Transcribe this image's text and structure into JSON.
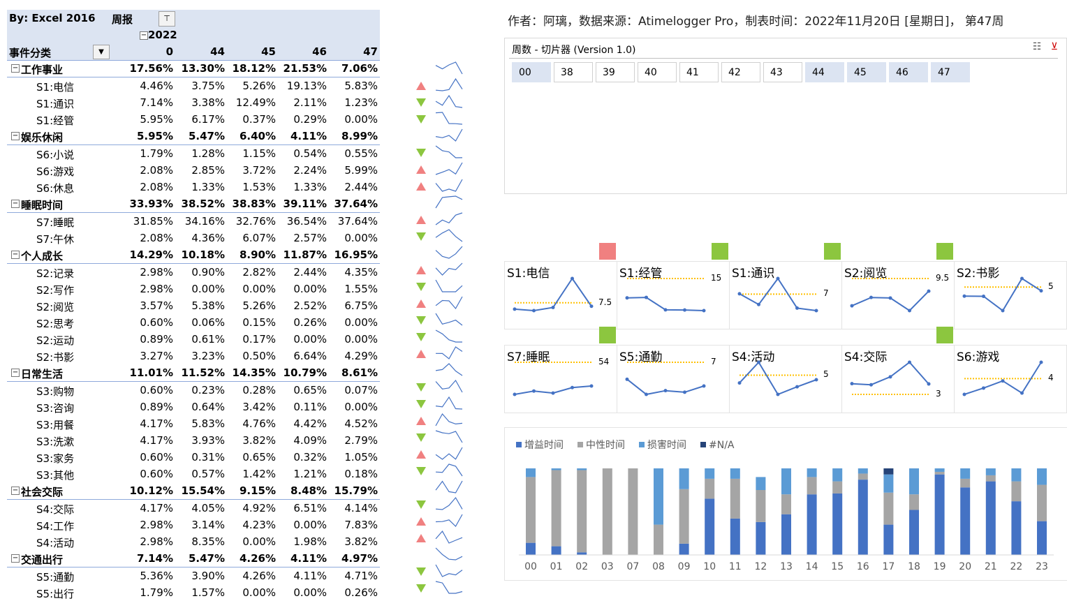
{
  "pivot": {
    "by_label": "By:  Excel 2016",
    "report_label": "周报",
    "year": "2022",
    "row_header": "事件分类",
    "columns": [
      "0",
      "44",
      "45",
      "46",
      "47"
    ],
    "rows": [
      {
        "type": "cat",
        "label": "工作事业",
        "values": [
          "17.56%",
          "13.30%",
          "18.12%",
          "21.53%",
          "7.06%"
        ],
        "trend": "up"
      },
      {
        "type": "sub",
        "label": "S1:电信",
        "values": [
          "4.46%",
          "3.75%",
          "5.26%",
          "19.13%",
          "5.83%"
        ],
        "trend": "up"
      },
      {
        "type": "sub",
        "label": "S1:通识",
        "values": [
          "7.14%",
          "3.38%",
          "12.49%",
          "2.11%",
          "1.23%"
        ],
        "trend": "down"
      },
      {
        "type": "sub",
        "label": "S1:经管",
        "values": [
          "5.95%",
          "6.17%",
          "0.37%",
          "0.29%",
          "0.00%"
        ],
        "trend": "down"
      },
      {
        "type": "cat",
        "label": "娱乐休闲",
        "values": [
          "5.95%",
          "5.47%",
          "6.40%",
          "4.11%",
          "8.99%"
        ],
        "trend": "up"
      },
      {
        "type": "sub",
        "label": "S6:小说",
        "values": [
          "1.79%",
          "1.28%",
          "1.15%",
          "0.54%",
          "0.55%"
        ],
        "trend": "down"
      },
      {
        "type": "sub",
        "label": "S6:游戏",
        "values": [
          "2.08%",
          "2.85%",
          "3.72%",
          "2.24%",
          "5.99%"
        ],
        "trend": "up"
      },
      {
        "type": "sub",
        "label": "S6:休息",
        "values": [
          "2.08%",
          "1.33%",
          "1.53%",
          "1.33%",
          "2.44%"
        ],
        "trend": "up"
      },
      {
        "type": "cat",
        "label": "睡眠时间",
        "values": [
          "33.93%",
          "38.52%",
          "38.83%",
          "39.11%",
          "37.64%"
        ],
        "trend": "up"
      },
      {
        "type": "sub",
        "label": "S7:睡眠",
        "values": [
          "31.85%",
          "34.16%",
          "32.76%",
          "36.54%",
          "37.64%"
        ],
        "trend": "up"
      },
      {
        "type": "sub",
        "label": "S7:午休",
        "values": [
          "2.08%",
          "4.36%",
          "6.07%",
          "2.57%",
          "0.00%"
        ],
        "trend": "down"
      },
      {
        "type": "cat",
        "label": "个人成长",
        "values": [
          "14.29%",
          "10.18%",
          "8.90%",
          "11.87%",
          "16.95%"
        ],
        "trend": "up"
      },
      {
        "type": "sub",
        "label": "S2:记录",
        "values": [
          "2.98%",
          "0.90%",
          "2.82%",
          "2.44%",
          "4.35%"
        ],
        "trend": "up"
      },
      {
        "type": "sub",
        "label": "S2:写作",
        "values": [
          "2.98%",
          "0.00%",
          "0.00%",
          "0.00%",
          "1.55%"
        ],
        "trend": "down"
      },
      {
        "type": "sub",
        "label": "S2:阅览",
        "values": [
          "3.57%",
          "5.38%",
          "5.26%",
          "2.52%",
          "6.75%"
        ],
        "trend": "up"
      },
      {
        "type": "sub",
        "label": "S2:思考",
        "values": [
          "0.60%",
          "0.06%",
          "0.15%",
          "0.26%",
          "0.00%"
        ],
        "trend": "down"
      },
      {
        "type": "sub",
        "label": "S2:运动",
        "values": [
          "0.89%",
          "0.61%",
          "0.17%",
          "0.00%",
          "0.00%"
        ],
        "trend": "down"
      },
      {
        "type": "sub",
        "label": "S2:书影",
        "values": [
          "3.27%",
          "3.23%",
          "0.50%",
          "6.64%",
          "4.29%"
        ],
        "trend": "up"
      },
      {
        "type": "cat",
        "label": "日常生活",
        "values": [
          "11.01%",
          "11.52%",
          "14.35%",
          "10.79%",
          "8.61%"
        ],
        "trend": "down"
      },
      {
        "type": "sub",
        "label": "S3:购物",
        "values": [
          "0.60%",
          "0.23%",
          "0.28%",
          "0.65%",
          "0.07%"
        ],
        "trend": "down"
      },
      {
        "type": "sub",
        "label": "S3:咨询",
        "values": [
          "0.89%",
          "0.64%",
          "3.42%",
          "0.11%",
          "0.00%"
        ],
        "trend": "down"
      },
      {
        "type": "sub",
        "label": "S3:用餐",
        "values": [
          "4.17%",
          "5.83%",
          "4.76%",
          "4.42%",
          "4.52%"
        ],
        "trend": "up"
      },
      {
        "type": "sub",
        "label": "S3:洗漱",
        "values": [
          "4.17%",
          "3.93%",
          "3.82%",
          "4.09%",
          "2.79%"
        ],
        "trend": "down"
      },
      {
        "type": "sub",
        "label": "S3:家务",
        "values": [
          "0.60%",
          "0.31%",
          "0.65%",
          "0.32%",
          "1.05%"
        ],
        "trend": "up"
      },
      {
        "type": "sub",
        "label": "S3:其他",
        "values": [
          "0.60%",
          "0.57%",
          "1.42%",
          "1.21%",
          "0.18%"
        ],
        "trend": "down"
      },
      {
        "type": "cat",
        "label": "社会交际",
        "values": [
          "10.12%",
          "15.54%",
          "9.15%",
          "8.48%",
          "15.79%"
        ],
        "trend": "up"
      },
      {
        "type": "sub",
        "label": "S4:交际",
        "values": [
          "4.17%",
          "4.05%",
          "4.92%",
          "6.51%",
          "4.14%"
        ],
        "trend": "down"
      },
      {
        "type": "sub",
        "label": "S4:工作",
        "values": [
          "2.98%",
          "3.14%",
          "4.23%",
          "0.00%",
          "7.83%"
        ],
        "trend": "up"
      },
      {
        "type": "sub",
        "label": "S4:活动",
        "values": [
          "2.98%",
          "8.35%",
          "0.00%",
          "1.98%",
          "3.82%"
        ],
        "trend": "up"
      },
      {
        "type": "cat",
        "label": "交通出行",
        "values": [
          "7.14%",
          "5.47%",
          "4.26%",
          "4.11%",
          "4.97%"
        ],
        "trend": "down"
      },
      {
        "type": "sub",
        "label": "S5:通勤",
        "values": [
          "5.36%",
          "3.90%",
          "4.26%",
          "4.11%",
          "4.71%"
        ],
        "trend": "down"
      },
      {
        "type": "sub",
        "label": "S5:出行",
        "values": [
          "1.79%",
          "1.57%",
          "0.00%",
          "0.00%",
          "0.26%"
        ],
        "trend": "down"
      }
    ]
  },
  "header_text": "作者：阿璃，数据来源：Atimelogger Pro，制表时间：2022年11月20日 [星期日]， 第47周",
  "slicer": {
    "title": "周数 - 切片器  (Version 1.0)",
    "items": [
      "00",
      "38",
      "39",
      "40",
      "41",
      "42",
      "43",
      "44",
      "45",
      "46",
      "47"
    ],
    "selected": [
      "00",
      "44",
      "45",
      "46",
      "47"
    ]
  },
  "colors": {
    "up": "#f08080",
    "down": "#8cc63f",
    "line": "#4472c4",
    "target": "#ffc000",
    "gain": "#4472c4",
    "neutral": "#a5a5a5",
    "harm": "#5b9bd5",
    "na": "#264478"
  },
  "mini_charts": [
    {
      "title": "S1:电信",
      "target_label": "7.5",
      "values": [
        4.46,
        3.75,
        5.26,
        19.13,
        5.83
      ],
      "target": 7.5,
      "flag": "up"
    },
    {
      "title": "S1:经管",
      "target_label": "15",
      "values": [
        5.95,
        6.17,
        0.37,
        0.29,
        0.0
      ],
      "target": 15,
      "flag": "down"
    },
    {
      "title": "S1:通识",
      "target_label": "7",
      "values": [
        7.14,
        3.38,
        12.49,
        2.11,
        1.23
      ],
      "target": 7,
      "flag": "down"
    },
    {
      "title": "S2:阅览",
      "target_label": "9.5",
      "values": [
        3.57,
        5.38,
        5.26,
        2.52,
        6.75
      ],
      "target": 9.5,
      "flag": "down"
    },
    {
      "title": "S2:书影",
      "target_label": "5",
      "values": [
        3.27,
        3.23,
        0.5,
        6.64,
        4.29
      ],
      "target": 5,
      "flag": "none"
    },
    {
      "title": "S7:睡眠",
      "target_label": "54",
      "values": [
        31.85,
        34.16,
        32.76,
        36.54,
        37.64
      ],
      "target": 54,
      "flag": "down"
    },
    {
      "title": "S5:通勤",
      "target_label": "7",
      "values": [
        5.36,
        3.9,
        4.26,
        4.11,
        4.71
      ],
      "target": 7,
      "flag": "none"
    },
    {
      "title": "S4:活动",
      "target_label": "5",
      "values": [
        2.98,
        8.35,
        0.0,
        1.98,
        3.82
      ],
      "target": 5,
      "flag": "none"
    },
    {
      "title": "S4:交际",
      "target_label": "3",
      "values": [
        4.17,
        4.05,
        4.92,
        6.51,
        4.14
      ],
      "target": 3,
      "flag": "down"
    },
    {
      "title": "S6:游戏",
      "target_label": "4",
      "values": [
        2.08,
        2.85,
        3.72,
        2.24,
        5.99
      ],
      "target": 4,
      "flag": "none"
    }
  ],
  "chart_data": {
    "type": "bar",
    "stacked": true,
    "categories": [
      "00",
      "01",
      "02",
      "03",
      "07",
      "08",
      "09",
      "10",
      "11",
      "12",
      "13",
      "14",
      "15",
      "16",
      "17",
      "18",
      "19",
      "20",
      "21",
      "22",
      "23"
    ],
    "series": [
      {
        "name": "增益时间",
        "values": [
          0.14,
          0.1,
          0.03,
          0.0,
          0.0,
          0.0,
          0.13,
          0.65,
          0.42,
          0.38,
          0.47,
          0.7,
          0.71,
          0.87,
          0.35,
          0.52,
          0.93,
          0.78,
          0.85,
          0.62,
          0.39
        ]
      },
      {
        "name": "中性时间",
        "values": [
          0.76,
          0.88,
          0.95,
          1.0,
          1.0,
          0.35,
          0.63,
          0.23,
          0.46,
          0.37,
          0.23,
          0.2,
          0.14,
          0.07,
          0.37,
          0.18,
          0.03,
          0.1,
          0.07,
          0.23,
          0.42
        ]
      },
      {
        "name": "损害时间",
        "values": [
          0.1,
          0.02,
          0.02,
          0.0,
          0.0,
          0.65,
          0.24,
          0.12,
          0.12,
          0.15,
          0.3,
          0.1,
          0.15,
          0.06,
          0.21,
          0.3,
          0.04,
          0.12,
          0.08,
          0.15,
          0.19
        ]
      },
      {
        "name": "#N/A",
        "values": [
          0,
          0,
          0,
          0,
          0,
          0,
          0,
          0,
          0,
          0,
          0,
          0,
          0,
          0,
          0.07,
          0,
          0,
          0,
          0,
          0,
          0
        ]
      }
    ],
    "ylim": [
      0,
      1
    ],
    "legend": "top-left"
  }
}
